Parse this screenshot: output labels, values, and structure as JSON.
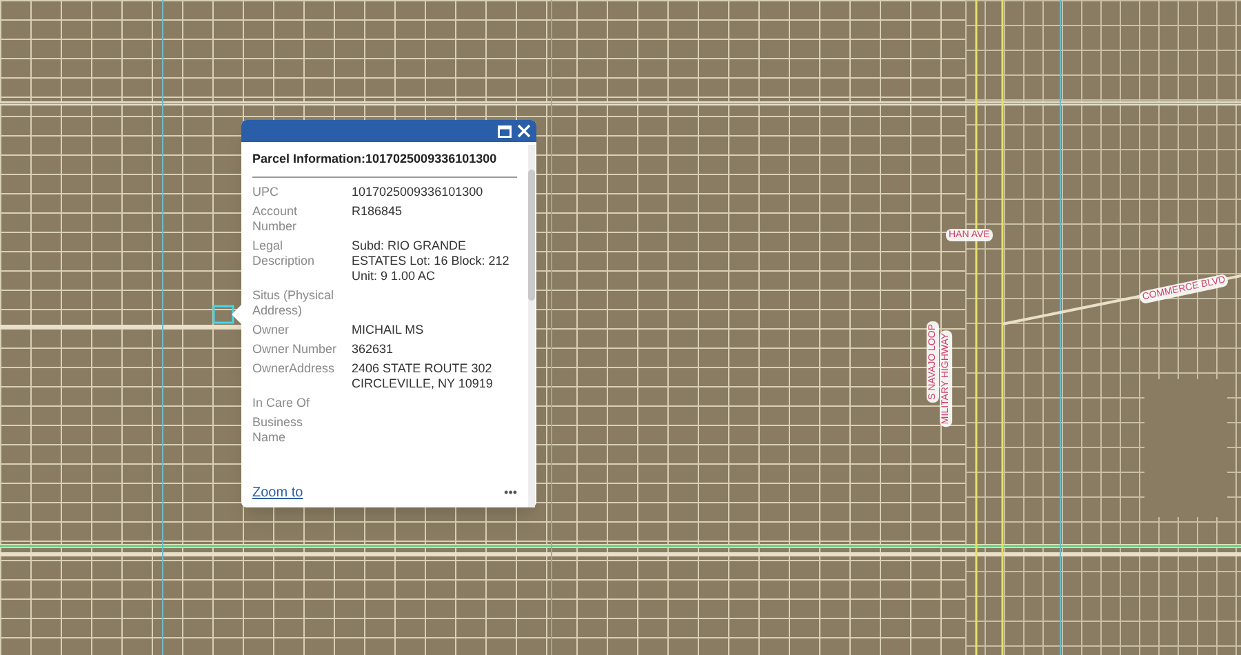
{
  "map": {
    "road_labels": [
      {
        "text": "HAN AVE",
        "kind": "horizontal"
      },
      {
        "text": "S NAVAJO LOOP",
        "kind": "vertical"
      },
      {
        "text": "MILITARY HIGHWAY",
        "kind": "vertical"
      },
      {
        "text": "COMMERCE BLVD",
        "kind": "angled"
      }
    ]
  },
  "popup": {
    "title": "Parcel Information:1017025009336101300",
    "fields": [
      {
        "label": "UPC",
        "value": "1017025009336101300"
      },
      {
        "label": "Account Number",
        "value": "R186845"
      },
      {
        "label": "Legal Description",
        "value": "Subd: RIO GRANDE ESTATES Lot: 16 Block: 212 Unit: 9 1.00 AC"
      },
      {
        "label": "Situs (Physical Address)"
      },
      {
        "label": "Owner",
        "value": "MICHAIL MS"
      },
      {
        "label": "Owner Number",
        "value": "362631"
      },
      {
        "label": "OwnerAddress",
        "value": "2406 STATE ROUTE 302 CIRCLEVILLE, NY 10919"
      },
      {
        "label": "In Care Of"
      },
      {
        "label": "Business Name"
      }
    ],
    "zoom_link": "Zoom to",
    "more": "•••"
  }
}
